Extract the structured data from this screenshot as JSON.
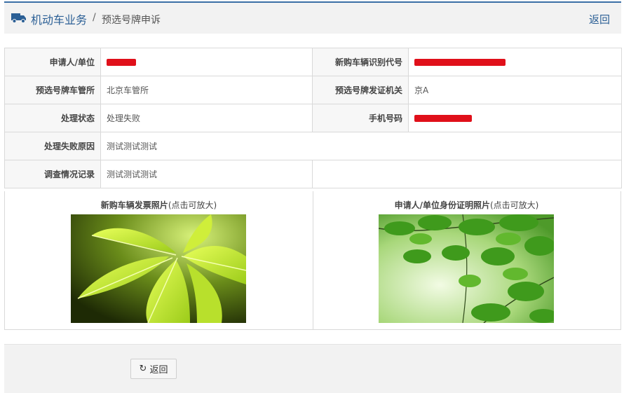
{
  "header": {
    "icon": "truck-icon",
    "breadcrumb_main": "机动车业务",
    "separator": "/",
    "breadcrumb_sub": "预选号牌申诉",
    "back_link": "返回"
  },
  "details": {
    "applicant_label": "申请人/单位",
    "vin_label": "新购车辆识别代号",
    "plate_office_label": "预选号牌车管所",
    "plate_office_value": "北京车管所",
    "issuing_authority_label": "预选号牌发证机关",
    "issuing_authority_value": "京A",
    "status_label": "处理状态",
    "status_value": "处理失败",
    "phone_label": "手机号码",
    "failure_reason_label": "处理失败原因",
    "failure_reason_value": "测试测试测试",
    "investigation_label": "调查情况记录",
    "investigation_value": "测试测试测试"
  },
  "photos": {
    "invoice_title": "新购车辆发票照片",
    "invoice_hint": "(点击可放大)",
    "id_title": "申请人/单位身份证明照片",
    "id_hint": "(点击可放大)"
  },
  "footer": {
    "back_icon": "refresh-icon",
    "back_label": "返回"
  },
  "colors": {
    "accent": "#2b5f95",
    "redaction": "#e0101a"
  }
}
